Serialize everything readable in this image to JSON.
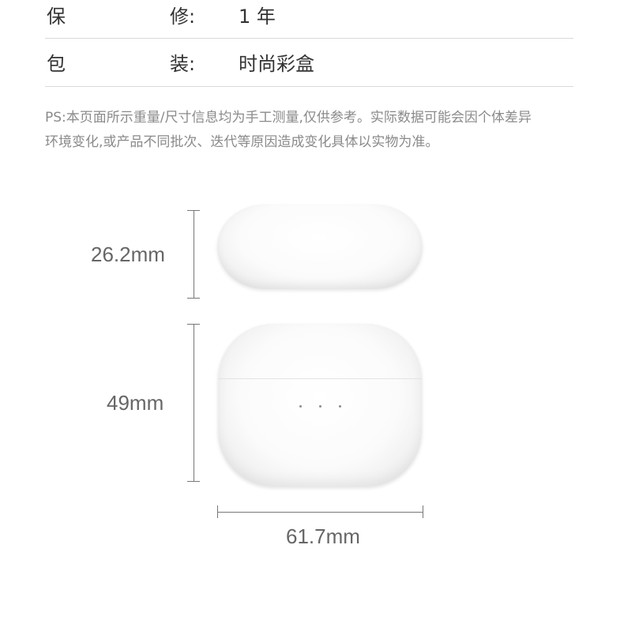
{
  "specs": [
    {
      "key_char1": "保",
      "key_char2": "修:",
      "value": "1 年"
    },
    {
      "key_char1": "包",
      "key_char2": "装:",
      "value": "时尚彩盒"
    }
  ],
  "note": {
    "line1": "PS:本页面所示重量/尺寸信息均为手工测量,仅供参考。实际数据可能会因个体差异",
    "line2": "环境变化,或产品不同批次、迭代等原因造成变化具体以实物为准。"
  },
  "dimensions": {
    "height": "26.2mm",
    "depth": "49mm",
    "width": "61.7mm"
  },
  "colors": {
    "text": "#333333",
    "note": "#8a8a8a",
    "divider": "#d9d9d9",
    "case": "#ffffff"
  }
}
